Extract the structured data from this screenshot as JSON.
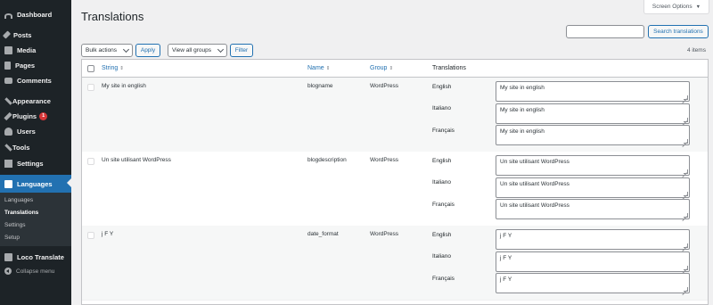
{
  "sidebar": {
    "items": [
      {
        "label": "Dashboard",
        "icon": "dashboard-icon"
      },
      {
        "label": "Posts",
        "icon": "pin-icon"
      },
      {
        "label": "Media",
        "icon": "media-icon"
      },
      {
        "label": "Pages",
        "icon": "pages-icon"
      },
      {
        "label": "Comments",
        "icon": "comments-icon"
      },
      {
        "label": "Appearance",
        "icon": "brush-icon"
      },
      {
        "label": "Plugins",
        "icon": "plugin-icon",
        "badge": "1"
      },
      {
        "label": "Users",
        "icon": "users-icon"
      },
      {
        "label": "Tools",
        "icon": "wrench-icon"
      },
      {
        "label": "Settings",
        "icon": "settings-icon"
      },
      {
        "label": "Languages",
        "icon": "languages-icon",
        "active": true
      },
      {
        "label": "Loco Translate",
        "icon": "loco-icon"
      }
    ],
    "submenu": [
      {
        "label": "Languages"
      },
      {
        "label": "Translations",
        "current": true
      },
      {
        "label": "Settings"
      },
      {
        "label": "Setup"
      }
    ],
    "collapse_label": "Collapse menu"
  },
  "header": {
    "title": "Translations",
    "screen_options": "Screen Options"
  },
  "search": {
    "value": "",
    "button": "Search translations"
  },
  "toolbar": {
    "bulk_actions": "Bulk actions",
    "apply": "Apply",
    "groups": "View all groups",
    "filter": "Filter",
    "items_count": "4 items"
  },
  "table": {
    "columns": {
      "string": "String",
      "name": "Name",
      "group": "Group",
      "translations": "Translations"
    },
    "rows": [
      {
        "string": "My site in english",
        "name": "blogname",
        "group": "WordPress",
        "translations": [
          {
            "language": "English",
            "value": "My site in english"
          },
          {
            "language": "Italiano",
            "value": "My site in english"
          },
          {
            "language": "Français",
            "value": "My site in english"
          }
        ]
      },
      {
        "string": "Un site utilisant WordPress",
        "name": "blogdescription",
        "group": "WordPress",
        "translations": [
          {
            "language": "English",
            "value": "Un site utilisant WordPress"
          },
          {
            "language": "Italiano",
            "value": "Un site utilisant WordPress"
          },
          {
            "language": "Français",
            "value": "Un site utilisant WordPress"
          }
        ]
      },
      {
        "string": "j F Y",
        "name": "date_format",
        "group": "WordPress",
        "translations": [
          {
            "language": "English",
            "value": "j F Y"
          },
          {
            "language": "Italiano",
            "value": "j F Y"
          },
          {
            "language": "Français",
            "value": "j F Y"
          }
        ]
      }
    ]
  },
  "colors": {
    "sidebar_bg": "#1d2327",
    "accent": "#2271b1",
    "badge": "#d63638",
    "page_bg": "#f0f0f1"
  }
}
